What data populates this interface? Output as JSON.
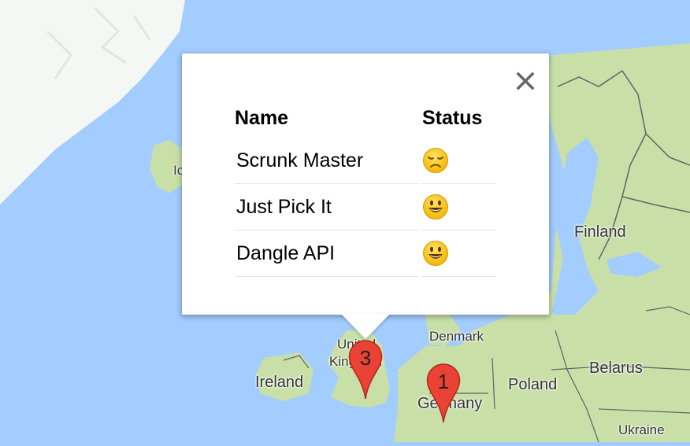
{
  "map": {
    "labels": {
      "iceland_partial": "Ic",
      "finland": "Finland",
      "united_kingdom_line1": "United",
      "united_kingdom_line2": "Kingdom",
      "ireland": "Ireland",
      "denmark": "Denmark",
      "belarus": "Belarus",
      "poland": "Poland",
      "germany": "Germany",
      "ukraine": "Ukraine"
    },
    "colors": {
      "water": "#a3ccff",
      "land": "#c8e0a8",
      "land_alt": "#d9e8c0",
      "snow": "#f4f7f4",
      "border": "#5f6368"
    },
    "markers": [
      {
        "number": "3",
        "color": "#ea4335"
      },
      {
        "number": "1",
        "color": "#ea4335"
      }
    ]
  },
  "popup": {
    "close_icon": "close-icon",
    "headers": {
      "name": "Name",
      "status": "Status"
    },
    "rows": [
      {
        "name": "Scrunk Master",
        "status": "disappointed-face"
      },
      {
        "name": "Just Pick It",
        "status": "smiley-face"
      },
      {
        "name": "Dangle API",
        "status": "smiley-face"
      }
    ]
  }
}
